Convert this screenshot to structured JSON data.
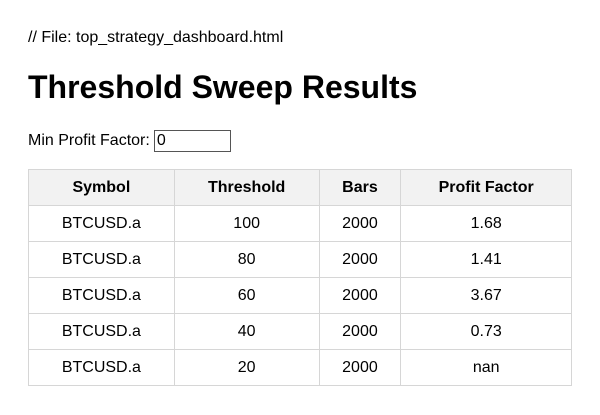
{
  "file_comment": "// File: top_strategy_dashboard.html",
  "title": "Threshold Sweep Results",
  "filter": {
    "label": "Min Profit Factor:",
    "value": "0"
  },
  "table": {
    "columns": [
      "Symbol",
      "Threshold",
      "Bars",
      "Profit Factor"
    ],
    "rows": [
      [
        "BTCUSD.a",
        "100",
        "2000",
        "1.68"
      ],
      [
        "BTCUSD.a",
        "80",
        "2000",
        "1.41"
      ],
      [
        "BTCUSD.a",
        "60",
        "2000",
        "3.67"
      ],
      [
        "BTCUSD.a",
        "40",
        "2000",
        "0.73"
      ],
      [
        "BTCUSD.a",
        "20",
        "2000",
        "nan"
      ]
    ]
  }
}
